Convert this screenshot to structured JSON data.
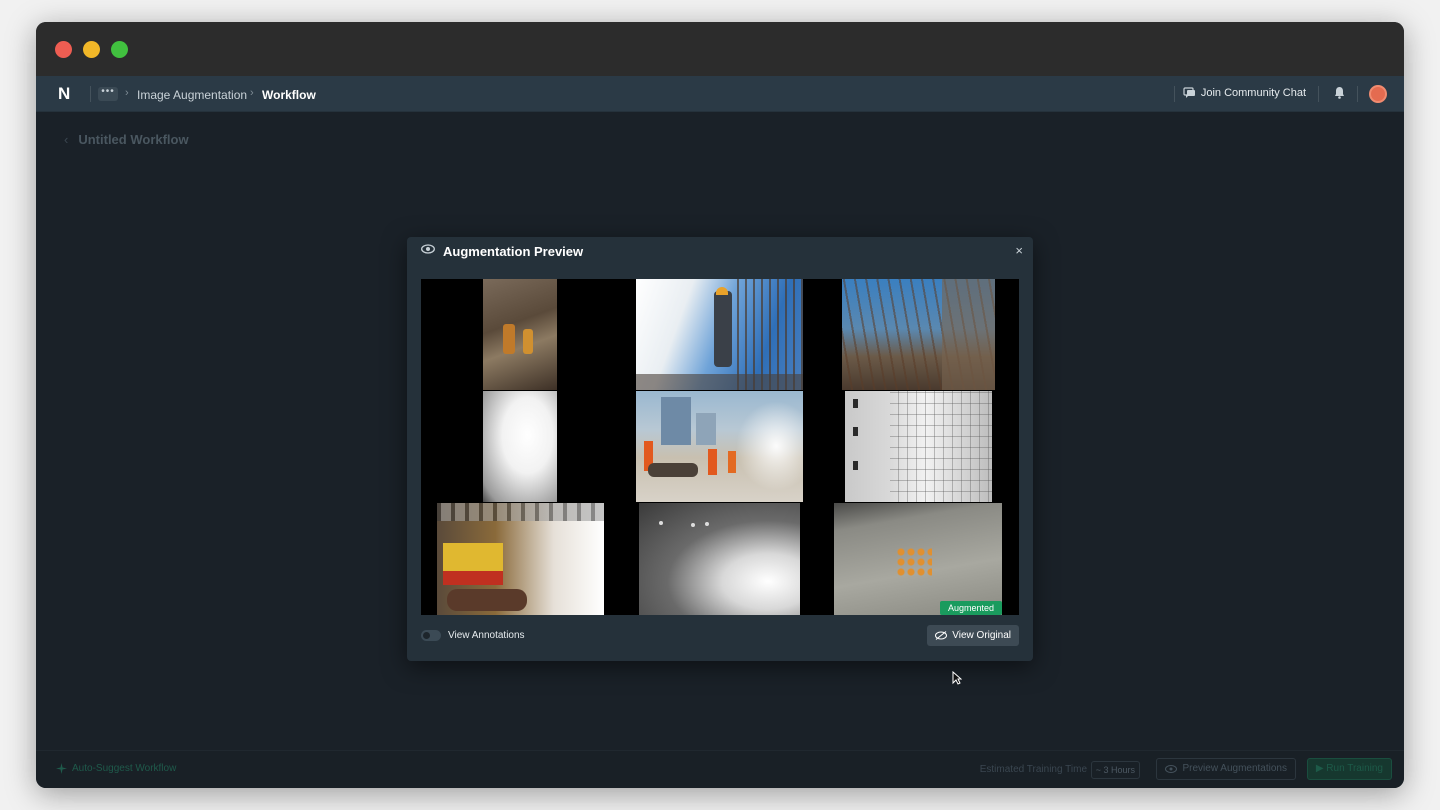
{
  "window": {
    "traffic_lights": [
      "close",
      "minimize",
      "zoom"
    ]
  },
  "appbar": {
    "logo": "N",
    "more_label": "•••",
    "breadcrumb": [
      "Image Augmentation",
      "Workflow"
    ],
    "community_label": "Join Community Chat",
    "icons": [
      "chat-icon",
      "bell-icon",
      "avatar"
    ]
  },
  "page": {
    "title": "Untitled Workflow"
  },
  "modal": {
    "title": "Augmentation Preview",
    "close_label": "×",
    "augmented_badge": "Augmented",
    "view_annotations_label": "View Annotations",
    "view_original_label": "View Original"
  },
  "bottombar": {
    "autosuggest_label": "Auto-Suggest Workflow",
    "estimated_label": "Estimated Training Time",
    "hours_label": "~ 3 Hours",
    "preview_label": "Preview Augmentations",
    "run_label": "Run Training"
  },
  "colors": {
    "window_bg": "#1a2128",
    "appbar_bg": "#2b3a46",
    "modal_bg": "#25313a",
    "badge_green": "#1a9b5e"
  }
}
